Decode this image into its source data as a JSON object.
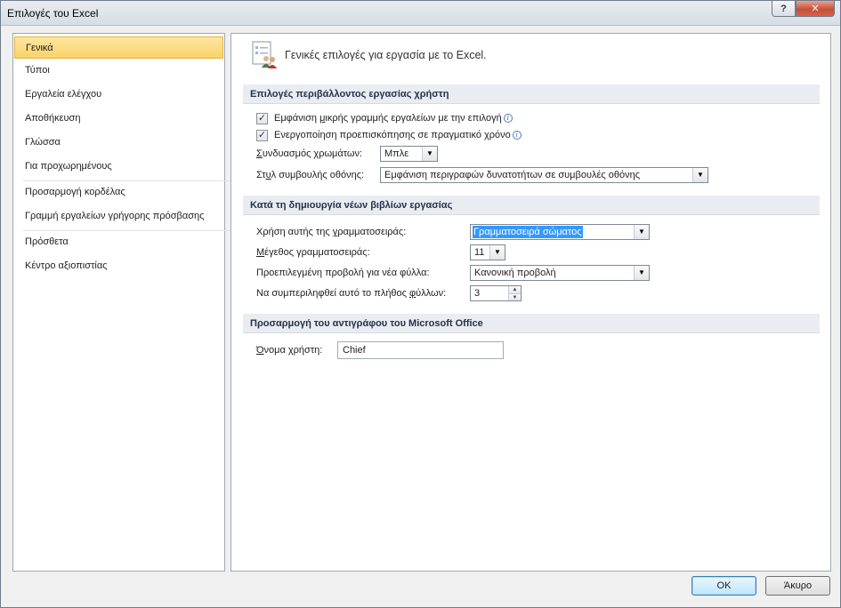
{
  "window": {
    "title": "Επιλογές του Excel",
    "help_glyph": "?",
    "close_glyph": "✕"
  },
  "sidebar": {
    "items": [
      {
        "label": "Γενικά",
        "selected": true
      },
      {
        "label": "Τύποι"
      },
      {
        "label": "Εργαλεία ελέγχου"
      },
      {
        "label": "Αποθήκευση"
      },
      {
        "label": "Γλώσσα"
      },
      {
        "label": "Για προχωρημένους"
      },
      {
        "label": "Προσαρμογή κορδέλας"
      },
      {
        "label": "Γραμμή εργαλείων γρήγορης πρόσβασης"
      },
      {
        "label": "Πρόσθετα"
      },
      {
        "label": "Κέντρο αξιοπιστίας"
      }
    ]
  },
  "main": {
    "header": "Γενικές επιλογές για εργασία με το Excel.",
    "sections": {
      "ui": {
        "title": "Επιλογές περιβάλλοντος εργασίας χρήστη",
        "mini_toolbar": {
          "pre": "Εμφάνιση ",
          "u": "μ",
          "post": "ικρής γραμμής εργαλείων με την επιλογή",
          "checked": true
        },
        "live_preview": {
          "pre": "Ενεργοποίηση προεπισκόπησης σε πραγματικό ",
          "u": "χ",
          "post": "ρόνο",
          "checked": true
        },
        "color_scheme": {
          "pre": "",
          "u": "Σ",
          "post": "υνδυασμός χρωμάτων:",
          "value": "Μπλε"
        },
        "screentip": {
          "pre": "Στ",
          "u": "υ",
          "post": "λ συμβουλής οθόνης:",
          "value": "Εμφάνιση περιγραφών δυνατοτήτων σε συμβουλές οθόνης"
        }
      },
      "new_workbooks": {
        "title": "Κατά τη δημιουργία νέων βιβλίων εργασίας",
        "font": {
          "pre": "Χρήση αυτής της ",
          "u": "γ",
          "post": "ραμματοσειράς:",
          "value": "Γραμματοσειρά σώματος"
        },
        "size": {
          "pre": "",
          "u": "Μ",
          "post": "έγεθος γραμματοσειράς:",
          "value": "11"
        },
        "view": {
          "pre": "Προεπιλεγμένη προβολή για νέα φύλλα:",
          "value": "Κανονική προβολή"
        },
        "sheets": {
          "pre": "Να συμπεριληφθεί αυτό το πλήθος ",
          "u": "φ",
          "post": "ύλλων:",
          "value": "3"
        }
      },
      "personalize": {
        "title": "Προσαρμογή του αντιγράφου του Microsoft Office",
        "username": {
          "pre": "",
          "u": "Ό",
          "post": "νομα χρήστη:",
          "value": "Chief"
        }
      }
    }
  },
  "footer": {
    "ok_label": "OK",
    "cancel_label": "Άκυρο"
  },
  "colors": {
    "selected_nav": "#fbd26a",
    "section_header": "#e9ecf0",
    "highlight": "#3399ff"
  },
  "icons": {
    "info": "info-icon",
    "header": "options-people-icon",
    "checkmark": "✓",
    "dropdown": "▼",
    "spin_up": "▲",
    "spin_down": "▼"
  }
}
